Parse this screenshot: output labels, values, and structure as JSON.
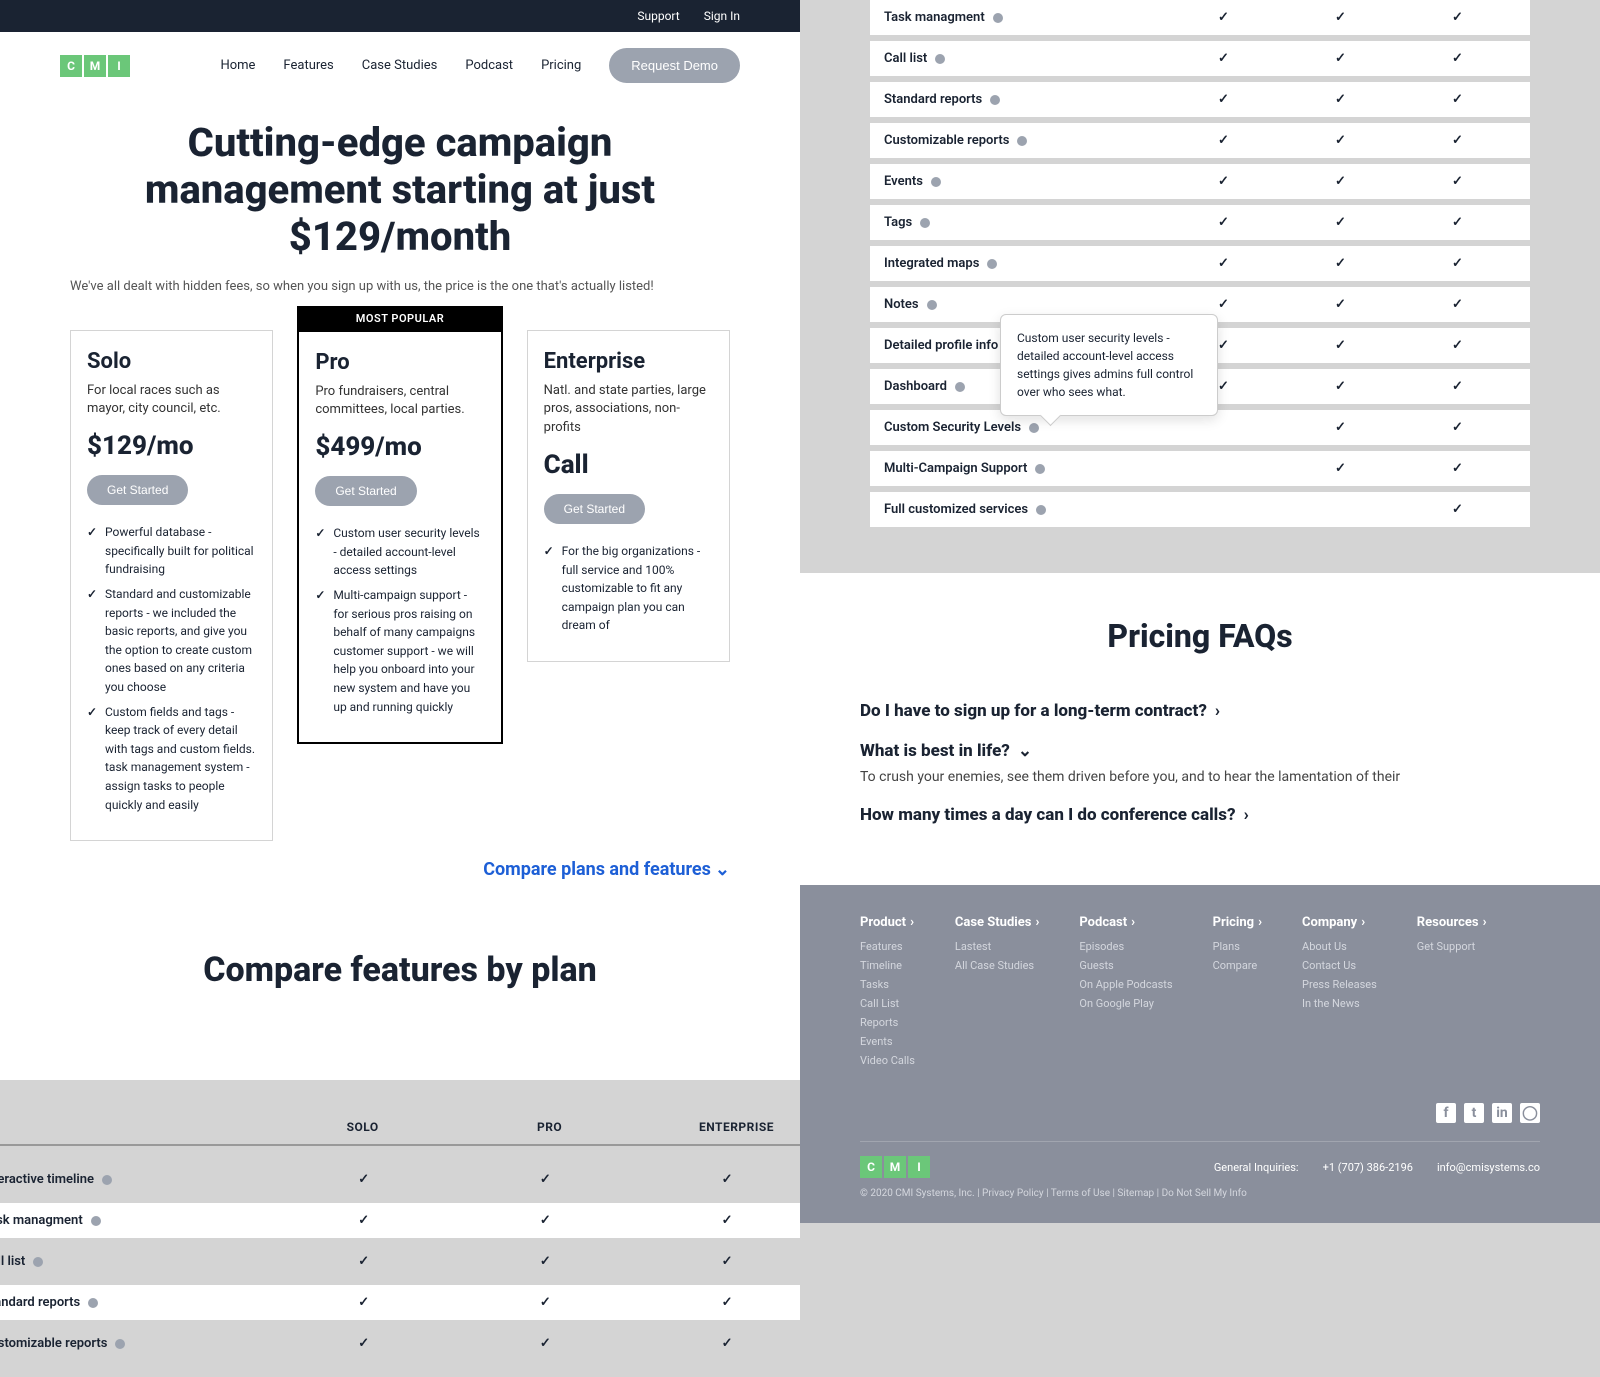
{
  "topbar": {
    "support": "Support",
    "signin": "Sign In"
  },
  "logo": [
    "C",
    "M",
    "I"
  ],
  "nav": {
    "home": "Home",
    "features": "Features",
    "cases": "Case Studies",
    "podcast": "Podcast",
    "pricing": "Pricing",
    "demo": "Request Demo"
  },
  "hero": {
    "title": "Cutting-edge campaign management starting at just $129/month",
    "sub": "We've all dealt with hidden fees, so when you sign up with us, the price is the one that's actually listed!"
  },
  "popular_badge": "MOST POPULAR",
  "cards": {
    "solo": {
      "name": "Solo",
      "desc": "For local races such as mayor, city council, etc.",
      "price": "$129/mo",
      "cta": "Get Started",
      "f1": "Powerful database - specifically built for political fundraising",
      "f2": "Standard and customizable reports - we included the basic reports, and give you the option to create custom ones based on any criteria you choose",
      "f3": "Custom fields and tags - keep track of every detail with tags and custom fields. task management system - assign tasks to people quickly and easily"
    },
    "pro": {
      "name": "Pro",
      "desc": "Pro fundraisers, central committees, local parties.",
      "price": "$499/mo",
      "cta": "Get Started",
      "f1": "Custom user security levels - detailed account-level access settings",
      "f2": "Multi-campaign support - for serious pros raising on behalf of many campaigns customer support - we will help you onboard into your new system and have you up and running quickly"
    },
    "ent": {
      "name": "Enterprise",
      "desc": "Natl. and state parties, large pros, associations, non-profits",
      "price": "Call",
      "cta": "Get Started",
      "f1": "For the big organizations - full service and 100% customizable to fit any campaign plan you can dream of"
    }
  },
  "compare_link": "Compare plans and features",
  "compare_title": "Compare features by plan",
  "plan_headers": {
    "solo": "SOLO",
    "pro": "PRO",
    "ent": "ENTERPRISE"
  },
  "features_left": [
    {
      "name": "Interactive timeline",
      "solo": true,
      "pro": true,
      "ent": true
    },
    {
      "name": "Task managment",
      "solo": true,
      "pro": true,
      "ent": true
    },
    {
      "name": "Call list",
      "solo": true,
      "pro": true,
      "ent": true
    },
    {
      "name": "Standard reports",
      "solo": true,
      "pro": true,
      "ent": true
    },
    {
      "name": "Customizable reports",
      "solo": true,
      "pro": true,
      "ent": true
    }
  ],
  "features_right": [
    {
      "name": "Task managment",
      "solo": true,
      "pro": true,
      "ent": true
    },
    {
      "name": "Call list",
      "solo": true,
      "pro": true,
      "ent": true
    },
    {
      "name": "Standard reports",
      "solo": true,
      "pro": true,
      "ent": true
    },
    {
      "name": "Customizable reports",
      "solo": true,
      "pro": true,
      "ent": true
    },
    {
      "name": "Events",
      "solo": true,
      "pro": true,
      "ent": true
    },
    {
      "name": "Tags",
      "solo": true,
      "pro": true,
      "ent": true
    },
    {
      "name": "Integrated maps",
      "solo": true,
      "pro": true,
      "ent": true
    },
    {
      "name": "Notes",
      "solo": true,
      "pro": true,
      "ent": true
    },
    {
      "name": "Detailed profile info",
      "solo": true,
      "pro": true,
      "ent": true,
      "tooltip": "Custom user security levels - detailed account-level access settings gives admins full control over who sees what."
    },
    {
      "name": "Dashboard",
      "solo": true,
      "pro": true,
      "ent": true
    },
    {
      "name": "Custom Security Levels",
      "solo": false,
      "pro": true,
      "ent": true
    },
    {
      "name": "Multi-Campaign Support",
      "solo": false,
      "pro": true,
      "ent": true
    },
    {
      "name": "Full customized services",
      "solo": false,
      "pro": false,
      "ent": true
    }
  ],
  "faq": {
    "title": "Pricing FAQs",
    "q1": "Do I have to sign up for a long-term contract?",
    "q2": "What is best in life?",
    "a2": "To crush your enemies, see them driven before you, and to hear the lamentation of their",
    "q3": "How many times a day can I do conference calls?"
  },
  "footer": {
    "cols": {
      "product": {
        "h": "Product",
        "links": [
          "Features",
          "Timeline",
          "Tasks",
          "Call List",
          "Reports",
          "Events",
          "Video Calls"
        ]
      },
      "cases": {
        "h": "Case Studies",
        "links": [
          "Lastest",
          "All Case Studies"
        ]
      },
      "podcast": {
        "h": "Podcast",
        "links": [
          "Episodes",
          "Guests",
          "On Apple Podcasts",
          "On Google Play"
        ]
      },
      "pricing": {
        "h": "Pricing",
        "links": [
          "Plans",
          "Compare"
        ]
      },
      "company": {
        "h": "Company",
        "links": [
          "About Us",
          "Contact Us",
          "Press Releases",
          "In the News"
        ]
      },
      "resources": {
        "h": "Resources",
        "links": [
          "Get Support"
        ]
      }
    },
    "inquiries_label": "General Inquiries:",
    "phone": "+1 (707) 386-2196",
    "email": "info@cmisystems.co",
    "legal": "© 2020 CMI Systems, Inc.  |  Privacy Policy  |  Terms of Use  |  Sitemap  |  Do Not Sell My Info"
  }
}
